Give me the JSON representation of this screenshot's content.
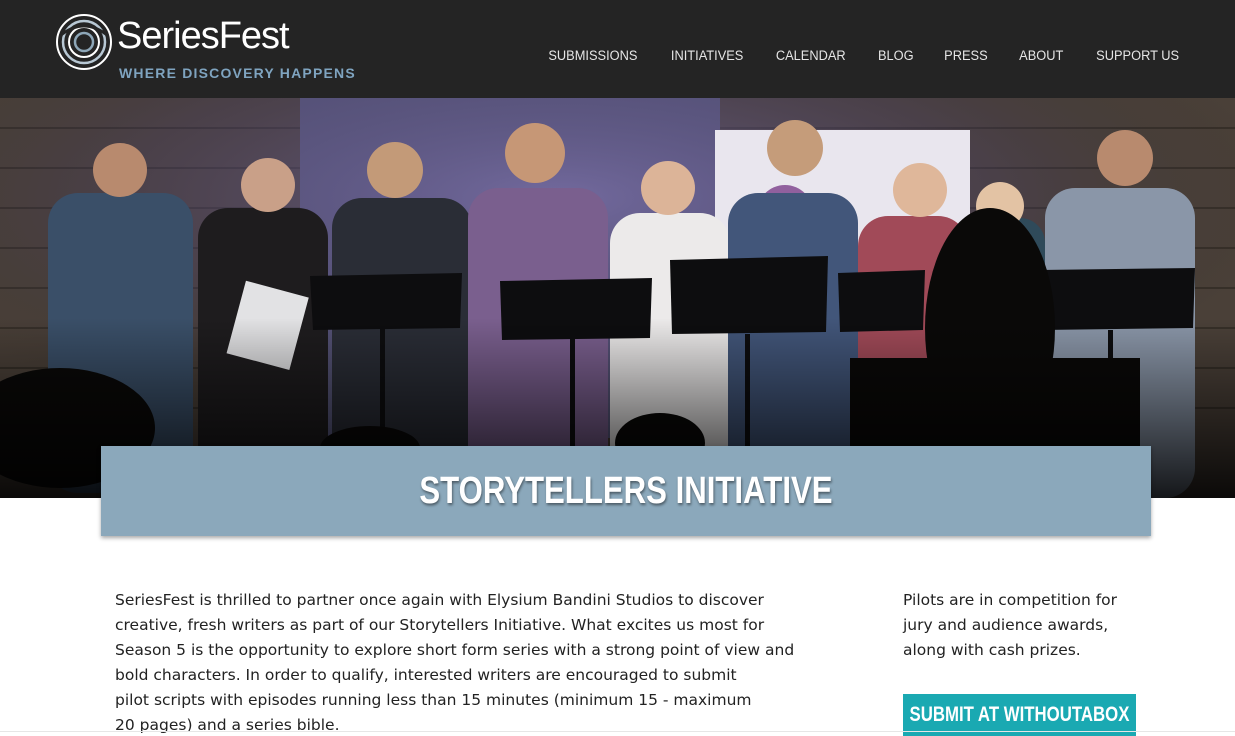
{
  "header": {
    "logo_name": "SeriesFest",
    "logo_tagline": "WHERE DISCOVERY HAPPENS",
    "nav": [
      {
        "label": "SUBMISSIONS"
      },
      {
        "label": "INITIATIVES"
      },
      {
        "label": "CALENDAR"
      },
      {
        "label": "BLOG"
      },
      {
        "label": "PRESS"
      },
      {
        "label": "ABOUT"
      },
      {
        "label": "SUPPORT US"
      }
    ]
  },
  "banner": {
    "title": "STORYTELLERS INITIATIVE"
  },
  "main": {
    "intro_lines": [
      "SeriesFest is thrilled to partner once again with Elysium Bandini Studios to discover",
      "creative, fresh writers as part of our Storytellers Initiative. What excites us most for",
      "Season 5 is the opportunity to explore short form series with a strong point of view and",
      "bold characters. In order to qualify, interested writers are encouraged to submit",
      "pilot scripts with episodes running less than 15 minutes (minimum 15 - maximum",
      "20 pages) and a series bible."
    ]
  },
  "sidebar": {
    "lines": [
      "Pilots are in competition for",
      "jury and audience awards,",
      "along with cash prizes."
    ],
    "cta_label": "SUBMIT AT WITHOUTABOX"
  },
  "colors": {
    "header_bg": "#242424",
    "banner_bg": "#8ba8bb",
    "cta_bg": "#1aa9b2",
    "tagline": "#7fa4c0"
  }
}
